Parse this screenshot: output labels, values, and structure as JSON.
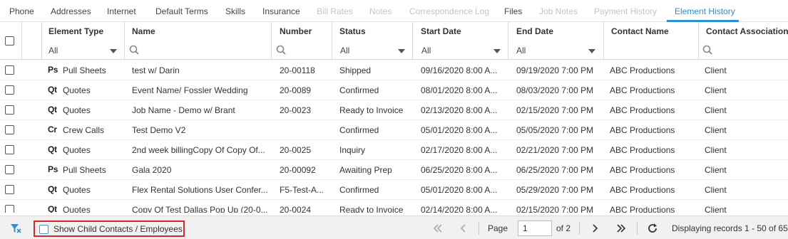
{
  "tabs": [
    {
      "label": "Phone",
      "state": "normal"
    },
    {
      "label": "Addresses",
      "state": "normal"
    },
    {
      "label": "Internet",
      "state": "normal"
    },
    {
      "label": "Default Terms",
      "state": "normal"
    },
    {
      "label": "Skills",
      "state": "normal"
    },
    {
      "label": "Insurance",
      "state": "normal"
    },
    {
      "label": "Bill Rates",
      "state": "disabled"
    },
    {
      "label": "Notes",
      "state": "disabled"
    },
    {
      "label": "Correspondence Log",
      "state": "disabled"
    },
    {
      "label": "Files",
      "state": "normal"
    },
    {
      "label": "Job Notes",
      "state": "disabled"
    },
    {
      "label": "Payment History",
      "state": "disabled"
    },
    {
      "label": "Element History",
      "state": "active"
    }
  ],
  "grid": {
    "columns": {
      "element_type": "Element Type",
      "name": "Name",
      "number": "Number",
      "status": "Status",
      "start_date": "Start Date",
      "end_date": "End Date",
      "contact_name": "Contact Name",
      "contact_association": "Contact Association"
    },
    "filters": {
      "element_type": "All",
      "status": "All",
      "start_date": "All",
      "end_date": "All"
    },
    "rows": [
      {
        "icon": "Ps",
        "type": "Pull Sheets",
        "name": "test w/ Darin",
        "number": "20-00118",
        "status": "Shipped",
        "start": "09/16/2020 8:00 A...",
        "end": "09/19/2020 7:00 PM",
        "contact": "ABC Productions",
        "assoc": "Client"
      },
      {
        "icon": "Qt",
        "type": "Quotes",
        "name": "Event Name/ Fossler Wedding",
        "number": "20-0089",
        "status": "Confirmed",
        "start": "08/01/2020 8:00 A...",
        "end": "08/03/2020 7:00 PM",
        "contact": "ABC Productions",
        "assoc": "Client"
      },
      {
        "icon": "Qt",
        "type": "Quotes",
        "name": "Job Name - Demo w/ Brant",
        "number": "20-0023",
        "status": "Ready to Invoice",
        "start": "02/13/2020 8:00 A...",
        "end": "02/15/2020 7:00 PM",
        "contact": "ABC Productions",
        "assoc": "Client"
      },
      {
        "icon": "Cr",
        "type": "Crew Calls",
        "name": "Test Demo V2",
        "number": "",
        "status": "Confirmed",
        "start": "05/01/2020 8:00 A...",
        "end": "05/05/2020 7:00 PM",
        "contact": "ABC Productions",
        "assoc": "Client"
      },
      {
        "icon": "Qt",
        "type": "Quotes",
        "name": "2nd week billingCopy Of Copy Of...",
        "number": "20-0025",
        "status": "Inquiry",
        "start": "02/17/2020 8:00 A...",
        "end": "02/21/2020 7:00 PM",
        "contact": "ABC Productions",
        "assoc": "Client"
      },
      {
        "icon": "Ps",
        "type": "Pull Sheets",
        "name": "Gala 2020",
        "number": "20-00092",
        "status": "Awaiting Prep",
        "start": "06/25/2020 8:00 A...",
        "end": "06/25/2020 7:00 PM",
        "contact": "ABC Productions",
        "assoc": "Client"
      },
      {
        "icon": "Qt",
        "type": "Quotes",
        "name": "Flex Rental Solutions User Confer...",
        "number": "F5-Test-A...",
        "status": "Confirmed",
        "start": "05/01/2020 8:00 A...",
        "end": "05/29/2020 7:00 PM",
        "contact": "ABC Productions",
        "assoc": "Client"
      },
      {
        "icon": "Qt",
        "type": "Quotes",
        "name": "Copy Of Test Dallas Pop Up (20-0...",
        "number": "20-0024",
        "status": "Ready to Invoice",
        "start": "02/14/2020 8:00 A...",
        "end": "02/15/2020 7:00 PM",
        "contact": "ABC Productions",
        "assoc": "Client"
      }
    ]
  },
  "footer": {
    "child_label": "Show Child Contacts / Employees",
    "page_label": "Page",
    "page_value": "1",
    "of_label": "of 2",
    "records": "Displaying records 1 - 50 of 65"
  },
  "colors": {
    "accent": "#2b8fd6",
    "highlight_border": "#d22a2a"
  }
}
